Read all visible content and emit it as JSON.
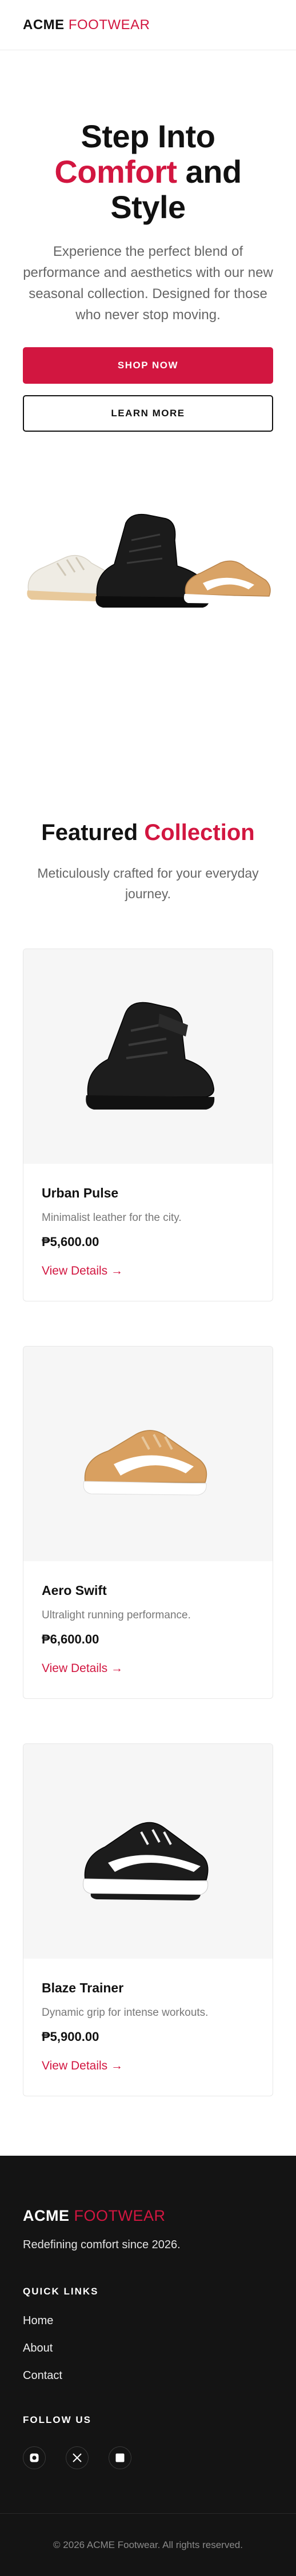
{
  "header": {
    "brand_main": "ACME",
    "brand_accent": "FOOTWEAR"
  },
  "hero": {
    "title_line1": "Step Into",
    "title_accent": "Comfort",
    "title_line2_rest": "and",
    "title_line3": "Style",
    "subtitle": "Experience the perfect blend of performance and aesthetics with our new seasonal collection. Designed for those who never stop moving.",
    "primary_cta": "SHOP NOW",
    "secondary_cta": "LEARN MORE"
  },
  "featured": {
    "title_main": "Featured",
    "title_accent": "Collection",
    "subtitle": "Meticulously crafted for your everyday journey.",
    "products": [
      {
        "name": "Urban Pulse",
        "description": "Minimalist leather for the city.",
        "price": "₱5,600.00",
        "link": "View Details →",
        "image": "black-high-top-sneaker"
      },
      {
        "name": "Aero Swift",
        "description": "Ultralight running performance.",
        "price": "₱6,600.00",
        "link": "View Details →",
        "image": "tan-low-top-sneaker"
      },
      {
        "name": "Blaze Trainer",
        "description": "Dynamic grip for intense workouts.",
        "price": "₱5,900.00",
        "link": "View Details →",
        "image": "black-white-trainer"
      }
    ]
  },
  "footer": {
    "brand_main": "ACME",
    "brand_accent": "FOOTWEAR",
    "tagline": "Redefining comfort since 2026.",
    "quick_links_heading": "QUICK LINKS",
    "quick_links": [
      "Home",
      "About",
      "Contact"
    ],
    "follow_heading": "FOLLOW US",
    "social": [
      "instagram-icon",
      "x-icon",
      "square-icon"
    ],
    "copyright": "© 2026 ACME Footwear. All rights reserved."
  },
  "colors": {
    "accent": "#d21640",
    "footer_bg": "#141414",
    "text": "#111111",
    "muted": "#666666"
  }
}
